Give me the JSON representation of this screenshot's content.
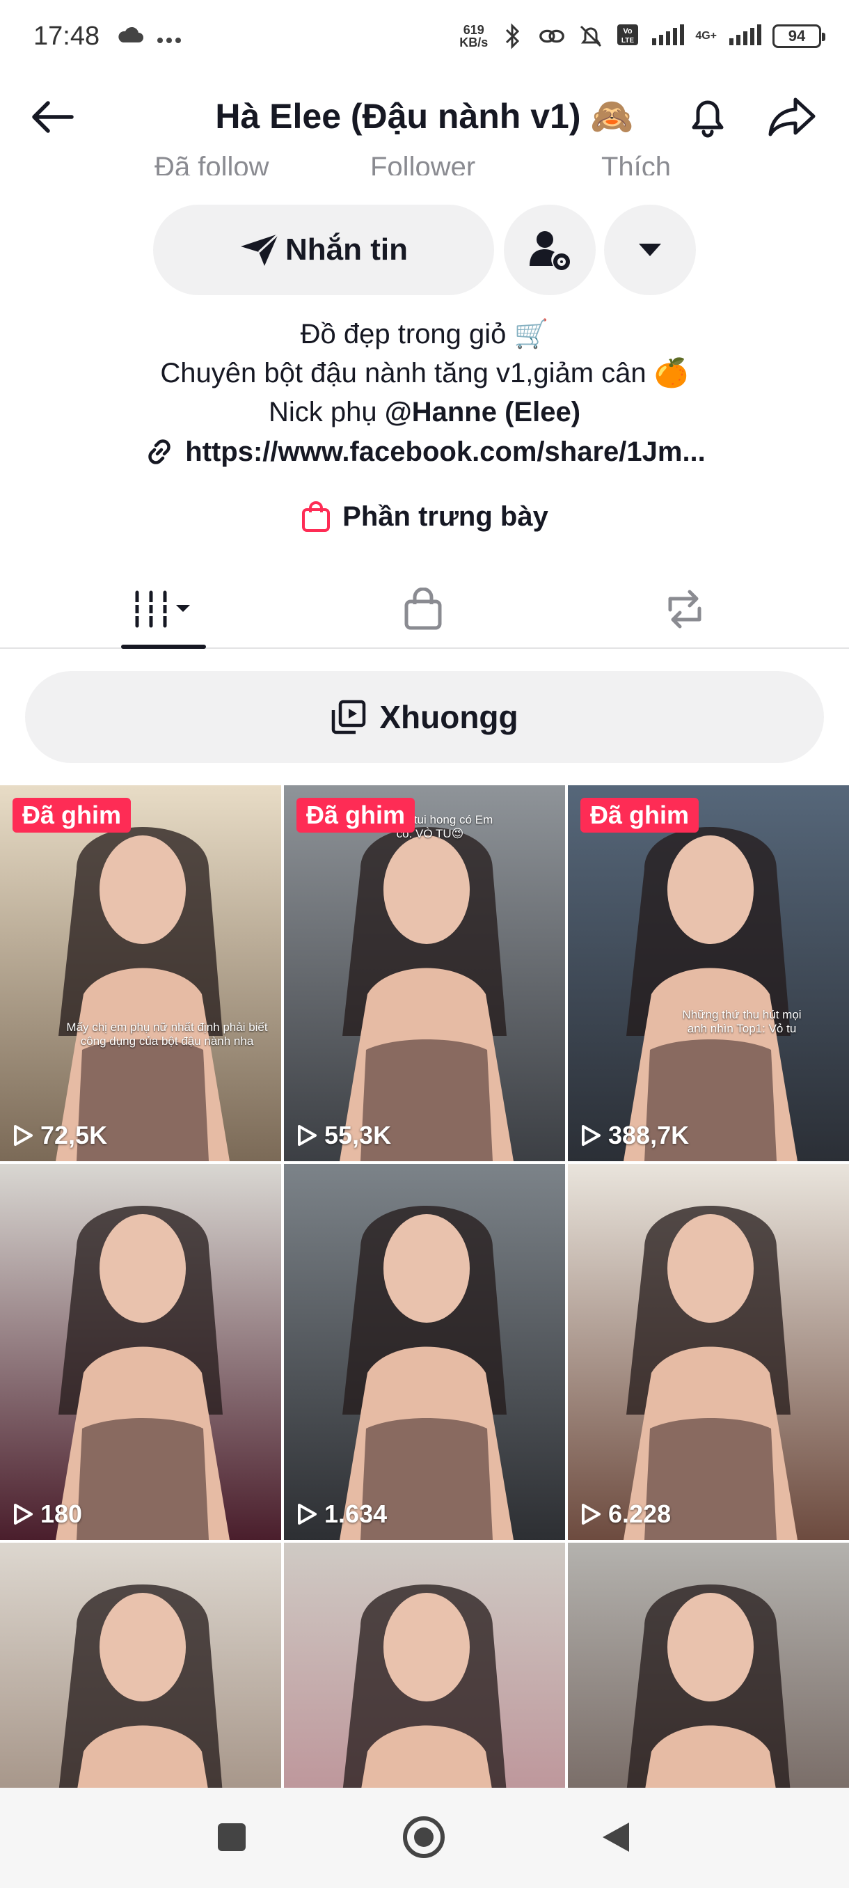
{
  "status_bar": {
    "time": "17:48",
    "speed_value": "619",
    "speed_unit": "KB/s",
    "network": "4G+",
    "battery": "94"
  },
  "header": {
    "profile_name": "Hà Elee (Đậu nành v1) 🙈"
  },
  "stats": {
    "following_label": "Đã follow",
    "followers_label": "Follower",
    "likes_label": "Thích"
  },
  "actions": {
    "message_label": "Nhắn tin"
  },
  "bio": {
    "line1": "Đồ đẹp trong giỏ 🛒",
    "line2": "Chuyên bột đậu nành tăng v1,giảm cân 🍊",
    "line3_prefix": "Nick phụ ",
    "line3_handle": "@Hanne (Elee)",
    "link": "https://www.facebook.com/share/1Jm..."
  },
  "showcase": {
    "label": "Phần trưng bày"
  },
  "playlist": {
    "label": "Xhuongg"
  },
  "videos": [
    {
      "pinned": "Đã ghim",
      "views": "72,5K",
      "caption": "Mấy chị em phụ nữ nhất định phải biết công dụng của bột đậu nành nha",
      "bg1": "#e8dcc6",
      "bg2": "#7b6a57"
    },
    {
      "pinned": "Đã ghim",
      "views": "55,3K",
      "caption": "Ai gì mà tui hong có Em có: VÒ TU😉",
      "bg1": "#8f9499",
      "bg2": "#3c3f44"
    },
    {
      "pinned": "Đã ghim",
      "views": "388,7K",
      "caption": "Những thứ thu hút mọi anh nhìn Top1: Vỏ tu",
      "bg1": "#56677a",
      "bg2": "#2b2f36"
    },
    {
      "pinned": "",
      "views": "180",
      "caption": "",
      "bg1": "#d9d7d2",
      "bg2": "#4a1e2c"
    },
    {
      "pinned": "",
      "views": "1.634",
      "caption": "",
      "bg1": "#7c8389",
      "bg2": "#2d2f33"
    },
    {
      "pinned": "",
      "views": "6.228",
      "caption": "",
      "bg1": "#e9e4dc",
      "bg2": "#6d4b3f"
    },
    {
      "pinned": "",
      "views": "",
      "caption": "",
      "bg1": "#ddd7cf",
      "bg2": "#8b7566"
    },
    {
      "pinned": "",
      "views": "",
      "caption": "",
      "bg1": "#cfcac4",
      "bg2": "#b57c86"
    },
    {
      "pinned": "",
      "views": "",
      "caption": "",
      "bg1": "#b4b2ae",
      "bg2": "#5c4a44"
    }
  ]
}
